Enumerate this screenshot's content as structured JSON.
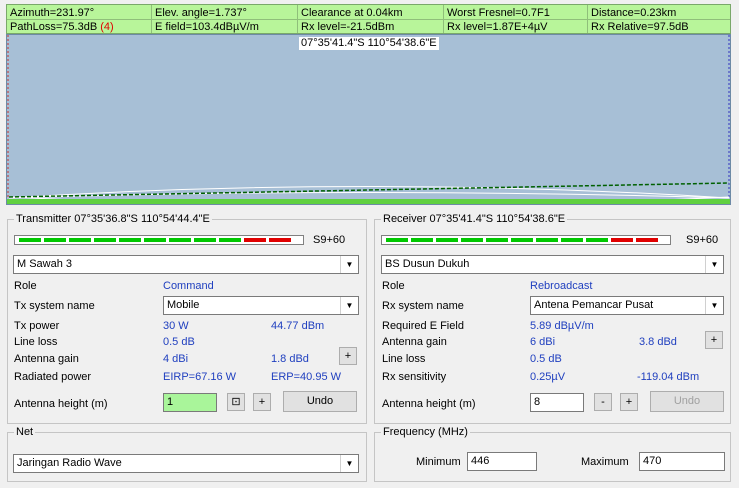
{
  "info": {
    "azimuth": "Azimuth=231.97°",
    "elev_angle": "Elev. angle=1.737°",
    "clearance": "Clearance at 0.04km",
    "worst_fresnel": "Worst Fresnel=0.7F1",
    "distance": "Distance=0.23km",
    "pathloss": "PathLoss=75.3dB",
    "pathloss_count": "(4)",
    "efield": "E field=103.4dBµV/m",
    "rx_level_dbm": "Rx level=-21.5dBm",
    "rx_level_uv": "Rx level=1.87E+4µV",
    "rx_relative": "Rx Relative=97.5dB"
  },
  "profile": {
    "coord_label": "07°35'41.4\"S 110°54'38.6\"E"
  },
  "transmitter": {
    "title": "Transmitter 07°35'36.8\"S 110°54'44.4\"E",
    "meter_label": "S9+60",
    "site": "M Sawah 3",
    "role_label": "Role",
    "role_value": "Command",
    "system_label": "Tx system name",
    "system_value": "Mobile",
    "power_label": "Tx power",
    "power_w": "30 W",
    "power_dbm": "44.77 dBm",
    "lineloss_label": "Line loss",
    "lineloss_value": "0.5 dB",
    "gain_label": "Antenna gain",
    "gain_dbi": "4 dBi",
    "gain_dbd": "1.8 dBd",
    "gain_btn": "+",
    "radiated_label": "Radiated power",
    "eirp": "EIRP=67.16 W",
    "erp": "ERP=40.95 W",
    "height_label": "Antenna height (m)",
    "height_value": "1",
    "icon_btn": "⊡",
    "plus_btn": "+",
    "undo": "Undo"
  },
  "receiver": {
    "title": "Receiver 07°35'41.4\"S 110°54'38.6\"E",
    "meter_label": "S9+60",
    "site": "BS Dusun Dukuh",
    "role_label": "Role",
    "role_value": "Rebroadcast",
    "system_label": "Rx system name",
    "system_value": "Antena Pemancar Pusat",
    "efield_label": "Required E Field",
    "efield_value": "5.89 dBµV/m",
    "gain_label": "Antenna gain",
    "gain_dbi": "6 dBi",
    "gain_dbd": "3.8 dBd",
    "gain_btn": "+",
    "lineloss_label": "Line loss",
    "lineloss_value": "0.5 dB",
    "sens_label": "Rx sensitivity",
    "sens_uv": "0.25µV",
    "sens_dbm": "-119.04 dBm",
    "height_label": "Antenna height (m)",
    "height_value": "8",
    "minus_btn": "-",
    "plus_btn": "+",
    "undo": "Undo"
  },
  "net": {
    "title": "Net",
    "value": "Jaringan Radio Wave"
  },
  "frequency": {
    "title": "Frequency (MHz)",
    "min_label": "Minimum",
    "min_value": "446",
    "max_label": "Maximum",
    "max_value": "470"
  },
  "colors": {
    "meter_green": "#00c800",
    "meter_red": "#e00000",
    "info_bg": "#b8f59a",
    "profile_bg": "#a7bfd6"
  }
}
